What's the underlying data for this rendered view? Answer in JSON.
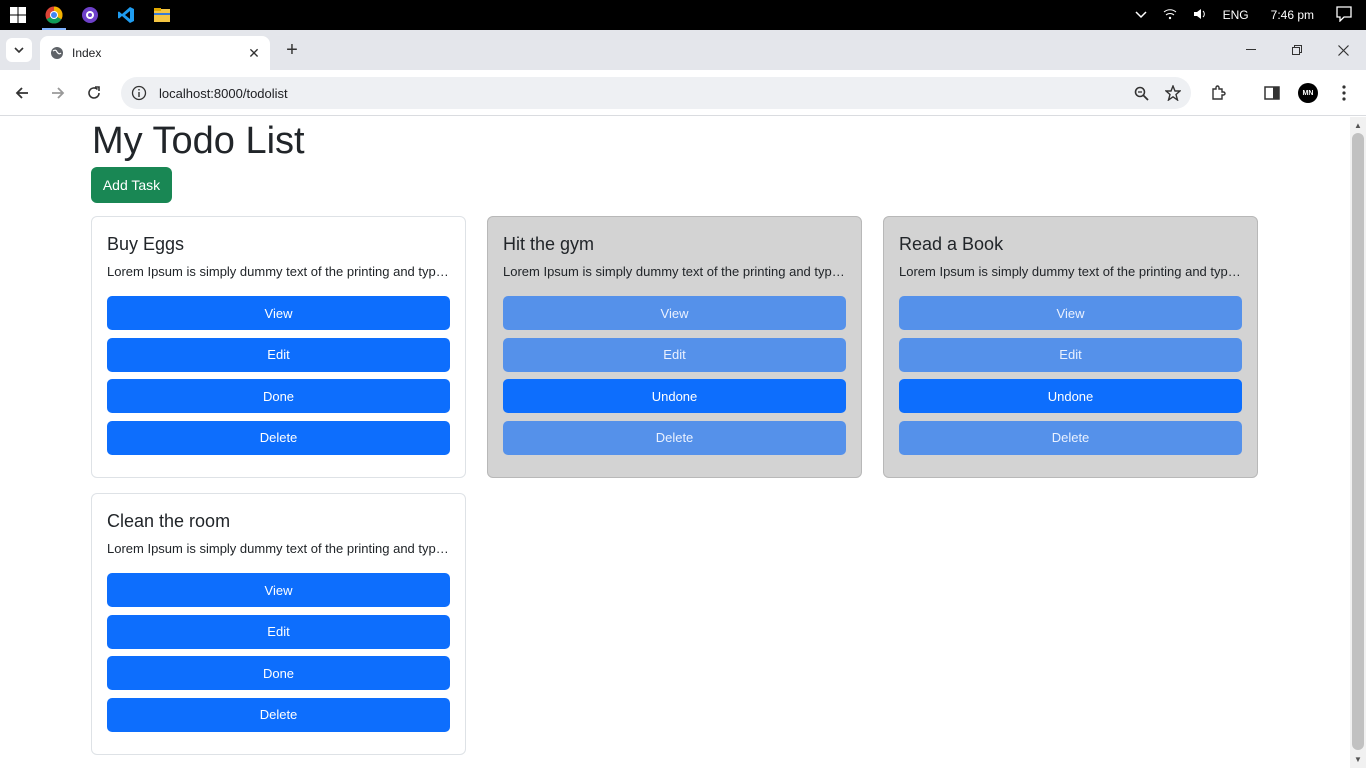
{
  "taskbar": {
    "apps": [
      "windows-start-icon",
      "chrome-icon",
      "github-desktop-icon",
      "vscode-icon",
      "file-explorer-icon"
    ],
    "tray": {
      "language": "ENG",
      "time": "7:46 pm"
    }
  },
  "browser": {
    "tab": {
      "title": "Index"
    },
    "url": "localhost:8000/todolist"
  },
  "avatar": {
    "initials": "MN"
  },
  "page": {
    "title": "My Todo List",
    "add_task_label": "Add Task"
  },
  "cards": [
    {
      "title": "Buy Eggs",
      "text": "Lorem Ipsum is simply dummy text of the printing and typesetting industry.",
      "done": false,
      "buttons": [
        "View",
        "Edit",
        "Done",
        "Delete"
      ]
    },
    {
      "title": "Hit the gym",
      "text": "Lorem Ipsum is simply dummy text of the printing and typesetting industry.",
      "done": true,
      "buttons": [
        "View",
        "Edit",
        "Undone",
        "Delete"
      ]
    },
    {
      "title": "Read a Book",
      "text": "Lorem Ipsum is simply dummy text of the printing and typesetting industry.",
      "done": true,
      "buttons": [
        "View",
        "Edit",
        "Undone",
        "Delete"
      ]
    },
    {
      "title": "Clean the room",
      "text": "Lorem Ipsum is simply dummy text of the printing and typesetting industry.",
      "done": false,
      "buttons": [
        "View",
        "Edit",
        "Done",
        "Delete"
      ]
    }
  ],
  "colors": {
    "primary": "#0d6efd",
    "success": "#198754",
    "done_card_bg": "#d3d3d3",
    "dimmed_button": "#5591ea"
  }
}
